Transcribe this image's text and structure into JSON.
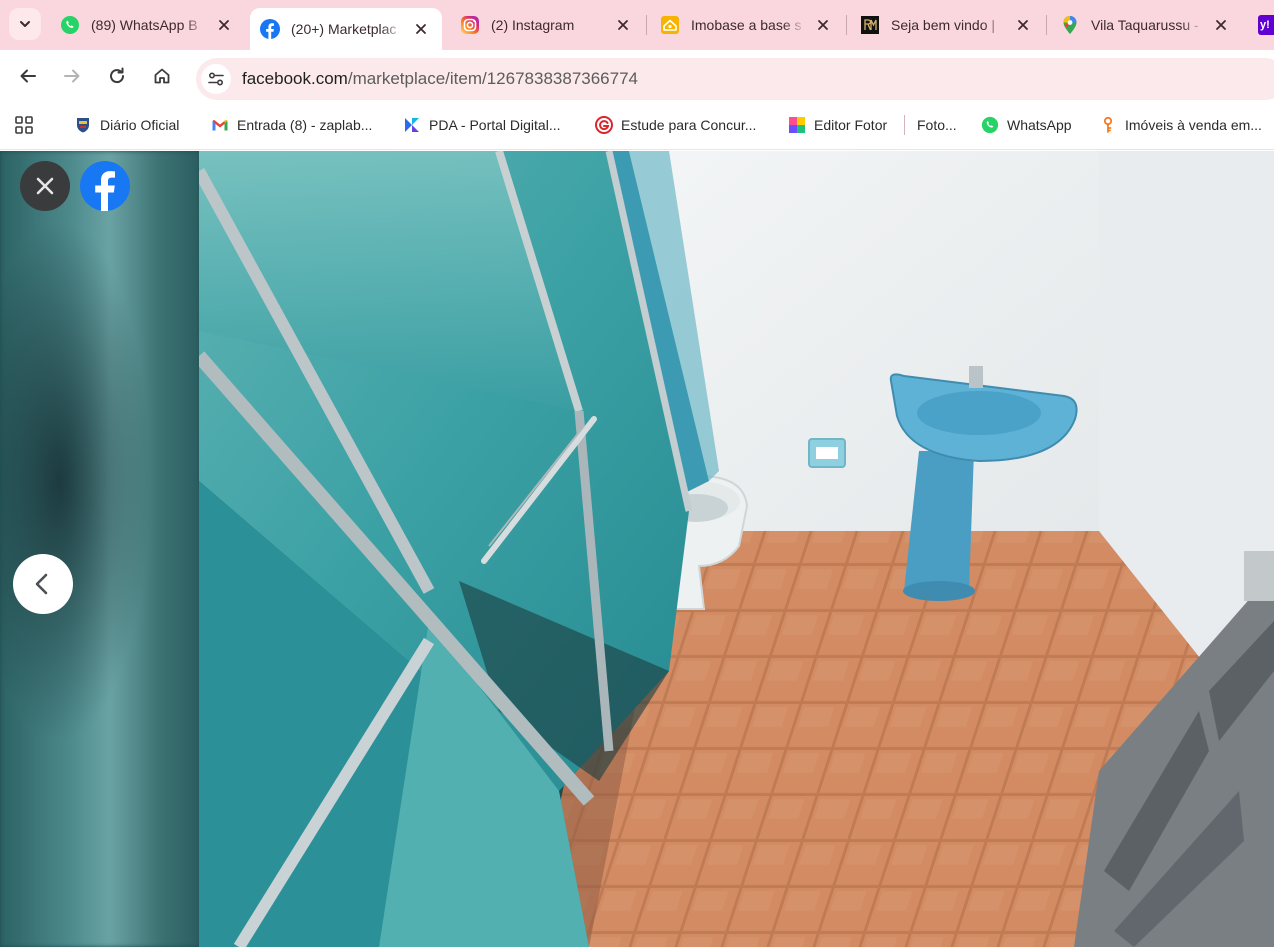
{
  "browser": {
    "tabs": [
      {
        "title": "(89) WhatsApp B",
        "favicon": "whatsapp-icon",
        "active": false
      },
      {
        "title": "(20+) Marketplac",
        "favicon": "facebook-icon",
        "active": true
      },
      {
        "title": "(2) Instagram",
        "favicon": "instagram-icon",
        "active": false
      },
      {
        "title": "Imobase a base s",
        "favicon": "imobase-icon",
        "active": false
      },
      {
        "title": "Seja bem vindo |",
        "favicon": "rm-logo-icon",
        "active": false
      },
      {
        "title": "Vila Taquarussu -",
        "favicon": "google-maps-icon",
        "active": false
      }
    ],
    "url": {
      "host": "facebook.com",
      "path": "/marketplace/item/1267838387366774"
    },
    "bookmarks": [
      {
        "label": "Diário Oficial",
        "icon": "coat-of-arms-icon"
      },
      {
        "label": "Entrada (8) - zaplab...",
        "icon": "gmail-icon"
      },
      {
        "label": "PDA - Portal Digital...",
        "icon": "kanban-k-icon"
      },
      {
        "label": "Estude para Concur...",
        "icon": "gran-g-icon"
      },
      {
        "label": "Editor Fotor",
        "icon": "fotor-icon"
      },
      {
        "label": "Foto...",
        "icon": ""
      },
      {
        "label": "WhatsApp",
        "icon": "whatsapp-icon"
      },
      {
        "label": "Imóveis à venda em...",
        "icon": "key-icon"
      }
    ]
  },
  "viewer": {
    "photo": "bathroom-photo",
    "close_icon": "close-icon",
    "logo": "facebook-logo-icon",
    "prev_icon": "chevron-left-icon"
  },
  "colors": {
    "tabstrip": "#fad7de",
    "omnibox": "#fbe9ec",
    "facebook_blue": "#1877f2",
    "whatsapp_green": "#25d366"
  }
}
